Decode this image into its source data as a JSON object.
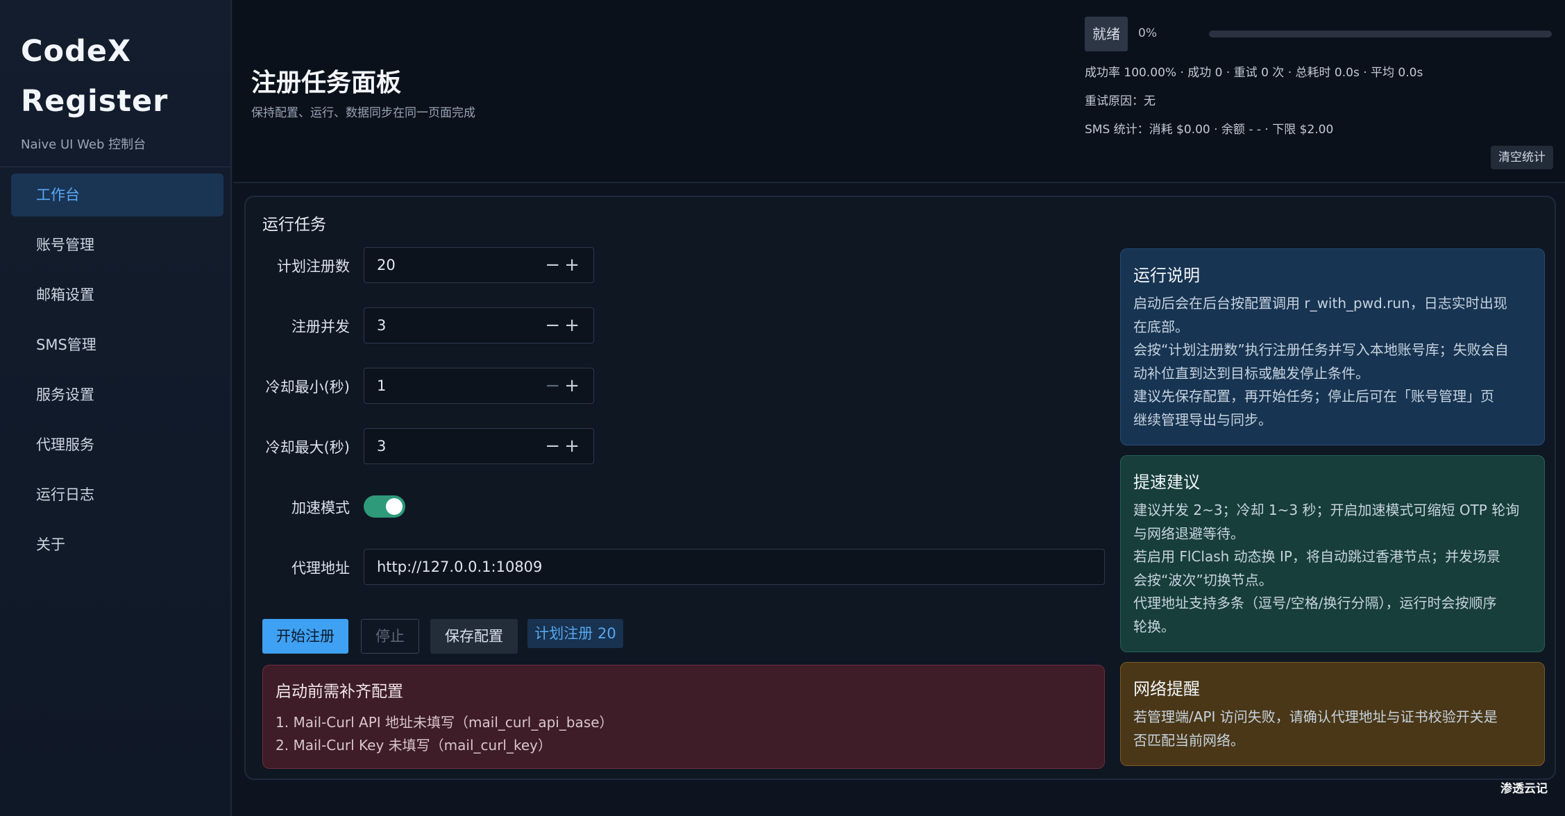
{
  "brand": {
    "title_line1": "CodeX",
    "title_line2": "Register",
    "subtitle": "Naive UI Web 控制台"
  },
  "nav": {
    "items": [
      {
        "label": "工作台",
        "active": true
      },
      {
        "label": "账号管理"
      },
      {
        "label": "邮箱设置"
      },
      {
        "label": "SMS管理"
      },
      {
        "label": "服务设置"
      },
      {
        "label": "代理服务"
      },
      {
        "label": "运行日志"
      },
      {
        "label": "关于"
      }
    ]
  },
  "header": {
    "title": "注册任务面板",
    "subtitle": "保持配置、运行、数据同步在同一页面完成",
    "status": "就绪",
    "progress_text": "0%",
    "progress_value": 0,
    "stats": "成功率 100.00% · 成功 0 · 重试 0 次 · 总耗时 0.0s · 平均 0.0s",
    "retry_reason": "重试原因：无",
    "sms_stats": "SMS 统计：消耗 $0.00 · 余额 - - · 下限 $2.00",
    "clear_label": "清空统计"
  },
  "task": {
    "title": "运行任务",
    "fields": {
      "planned": {
        "label": "计划注册数",
        "value": "20"
      },
      "concurrency": {
        "label": "注册并发",
        "value": "3"
      },
      "cooldown_min": {
        "label": "冷却最小(秒)",
        "value": "1"
      },
      "cooldown_max": {
        "label": "冷却最大(秒)",
        "value": "3"
      },
      "accel": {
        "label": "加速模式",
        "on": true
      },
      "proxy": {
        "label": "代理地址",
        "value": "http://127.0.0.1:10809"
      }
    },
    "stepper": {
      "minus": "−",
      "plus": "+"
    },
    "buttons": {
      "start": "开始注册",
      "stop": "停止",
      "save": "保存配置",
      "plan_tag": "计划注册 20"
    },
    "alert": {
      "title": "启动前需补齐配置",
      "lines": [
        "1. Mail-Curl API 地址未填写（mail_curl_api_base）",
        "2. Mail-Curl Key 未填写（mail_curl_key）"
      ]
    }
  },
  "panels": {
    "run": {
      "title": "运行说明",
      "lines": [
        "启动后会在后台按配置调用 r_with_pwd.run，日志实时出现",
        "在底部。",
        "会按“计划注册数”执行注册任务并写入本地账号库；失败会自",
        "动补位直到达到目标或触发停止条件。",
        "建议先保存配置，再开始任务；停止后可在「账号管理」页",
        "继续管理导出与同步。"
      ]
    },
    "speed": {
      "title": "提速建议",
      "lines": [
        "建议并发 2~3；冷却 1~3 秒；开启加速模式可缩短 OTP 轮询",
        "与网络退避等待。",
        "若启用 FlClash 动态换 IP，将自动跳过香港节点；并发场景",
        "会按“波次”切换节点。",
        "代理地址支持多条（逗号/空格/换行分隔），运行时会按顺序",
        "轮换。"
      ]
    },
    "network": {
      "title": "网络提醒",
      "lines": [
        "若管理端/API 访问失败，请确认代理地址与证书校验开关是",
        "否匹配当前网络。"
      ]
    }
  },
  "watermark": "渗透云记"
}
